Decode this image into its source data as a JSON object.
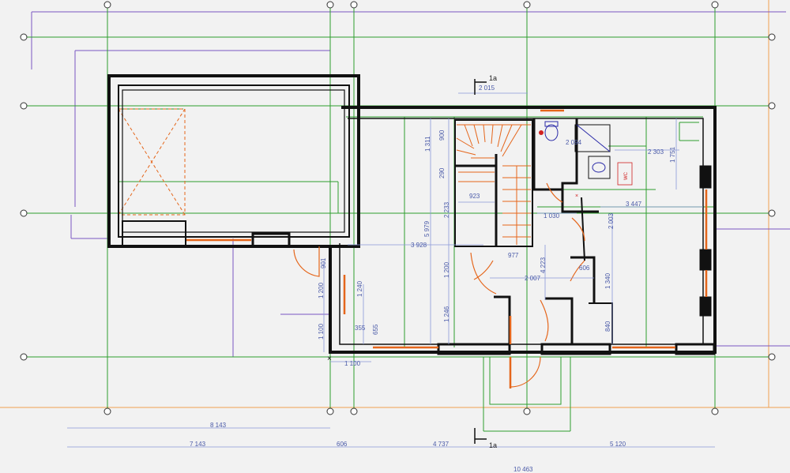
{
  "colors": {
    "background": "#f2f2f2",
    "grid_green": "#2e9e2e",
    "wall_black": "#111111",
    "window_orange": "#e5661b",
    "dimension_blue": "#4a5aa8",
    "outline_purple": "#7a57c2",
    "border_orange": "#f0a050"
  },
  "section_marks": {
    "top_label": "1a",
    "bottom_label": "1a"
  },
  "room_labels": {
    "wc": "WC"
  },
  "dimensions": {
    "stair_top": "2 015",
    "d_1311": "1 311",
    "d_900": "900",
    "d_290": "290",
    "d_923": "923",
    "d_2233": "2 233",
    "d_5979": "5 979",
    "d_3928": "3 928",
    "d_977": "977",
    "d_1200_mid": "1 200",
    "d_1246": "1 246",
    "d_1030": "1 030",
    "d_4223": "4 223",
    "d_2007": "2 007",
    "d_606": "606",
    "d_2094": "2 094",
    "d_2003": "2 003",
    "d_1340": "1 340",
    "d_840": "840",
    "d_2303": "2 303",
    "d_1751": "1 751",
    "d_3447": "3 447",
    "d_901": "901",
    "d_1200_left": "1 200",
    "d_1100_left": "1 100",
    "d_1240": "1 240",
    "d_355": "355",
    "d_655": "655",
    "d_1100_bottom": "1 100",
    "total_8143": "8 143",
    "seg_7143": "7 143",
    "seg_606": "606",
    "seg_4737": "4 737",
    "seg_5120": "5 120",
    "overall": "10 463"
  }
}
